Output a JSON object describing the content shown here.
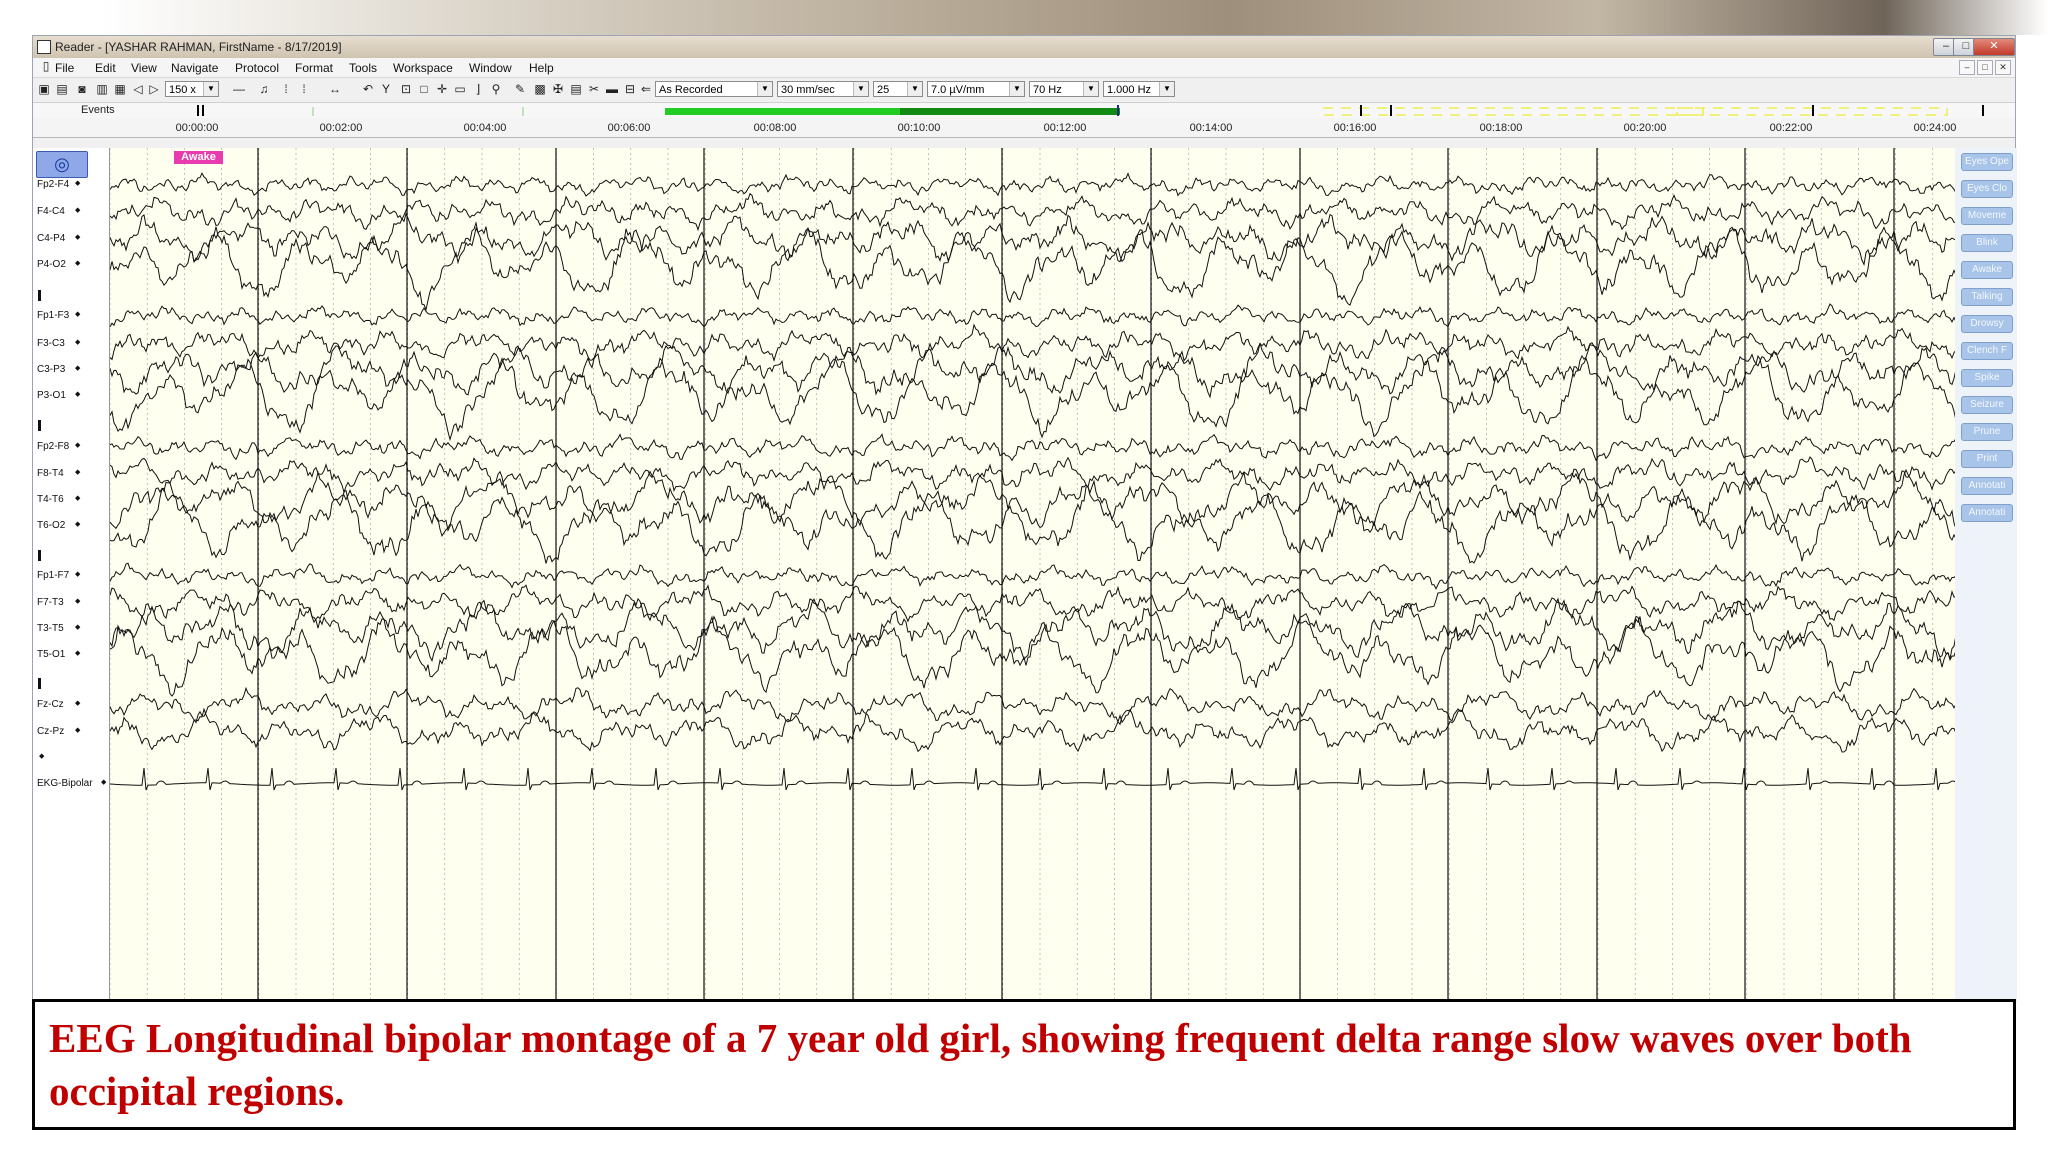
{
  "window": {
    "title": "Reader - [YASHAR RAHMAN, FirstName - 8/17/2019]",
    "controls": {
      "minimize": "–",
      "maximize": "□",
      "close": "✕"
    }
  },
  "menu": [
    "File",
    "Edit",
    "View",
    "Navigate",
    "Protocol",
    "Format",
    "Tools",
    "Workspace",
    "Window",
    "Help"
  ],
  "toolbar": {
    "zoom": "150 x",
    "montage": "As Recorded",
    "speed": "30 mm/sec",
    "channels": "25",
    "sensitivity": "7.0 µV/mm",
    "high_filter": "70 Hz",
    "low_filter": "1.000 Hz"
  },
  "events_label": "Events",
  "timeline": [
    "00:00:00",
    "00:02:00",
    "00:04:00",
    "00:06:00",
    "00:08:00",
    "00:10:00",
    "00:12:00",
    "00:14:00",
    "00:16:00",
    "00:18:00",
    "00:20:00",
    "00:22:00",
    "00:24:00"
  ],
  "annotation": {
    "label": "Awake",
    "color": "#e83cae"
  },
  "montage_button_icon": "target-icon",
  "channels": [
    {
      "label": "Fp2-F4",
      "amp": 9,
      "slow": 3
    },
    {
      "label": "F4-C4",
      "amp": 12,
      "slow": 6
    },
    {
      "label": "C4-P4",
      "amp": 15,
      "slow": 10
    },
    {
      "label": "P4-O2",
      "amp": 16,
      "slow": 22
    },
    {
      "label": "Fp1-F3",
      "amp": 9,
      "slow": 3
    },
    {
      "label": "F3-C3",
      "amp": 12,
      "slow": 6
    },
    {
      "label": "C3-P3",
      "amp": 15,
      "slow": 12
    },
    {
      "label": "P3-O1",
      "amp": 16,
      "slow": 22
    },
    {
      "label": "Fp2-F8",
      "amp": 10,
      "slow": 4
    },
    {
      "label": "F8-T4",
      "amp": 12,
      "slow": 6
    },
    {
      "label": "T4-T6",
      "amp": 15,
      "slow": 14
    },
    {
      "label": "T6-O2",
      "amp": 16,
      "slow": 20
    },
    {
      "label": "Fp1-F7",
      "amp": 9,
      "slow": 4
    },
    {
      "label": "F7-T3",
      "amp": 12,
      "slow": 7
    },
    {
      "label": "T3-T5",
      "amp": 15,
      "slow": 14
    },
    {
      "label": "T5-O1",
      "amp": 16,
      "slow": 20
    },
    {
      "label": "Fz-Cz",
      "amp": 11,
      "slow": 7
    },
    {
      "label": "Cz-Pz",
      "amp": 12,
      "slow": 9
    },
    {
      "label": "EKG-Bipolar",
      "amp": 4,
      "slow": 0
    }
  ],
  "event_buttons": [
    "Eyes Ope",
    "Eyes Clo",
    "Moveme",
    "Blink",
    "Awake",
    "Talking",
    "Drowsy",
    "Clench F",
    "Spike",
    "Seizure",
    "Prune",
    "Print",
    "Annotati",
    "Annotati"
  ],
  "caption": "EEG Longitudinal bipolar montage of a 7 year old girl, showing frequent delta range slow waves over both occipital regions."
}
